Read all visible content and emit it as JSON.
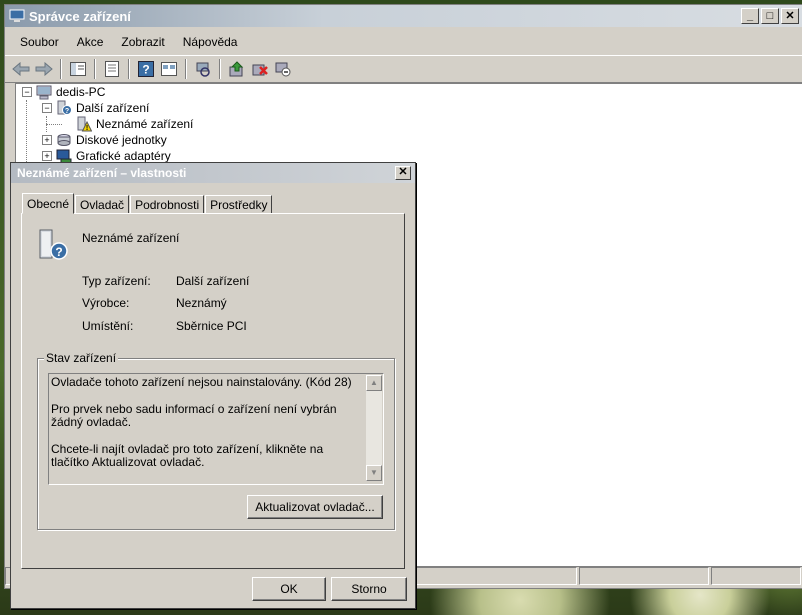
{
  "window": {
    "title": "Správce zařízení",
    "controls": [
      "_",
      "□",
      "✕"
    ]
  },
  "menu": [
    "Soubor",
    "Akce",
    "Zobrazit",
    "Nápověda"
  ],
  "toolbar_icons": [
    "back-icon",
    "forward-icon",
    "show-hide-tree-icon",
    "properties-icon",
    "help-icon",
    "view-icon",
    "scan-hardware-icon",
    "update-driver-icon",
    "uninstall-icon",
    "disable-icon"
  ],
  "tree": {
    "root": "dedis-PC",
    "other_devices": "Další zařízení",
    "unknown_device": "Neznámé zařízení",
    "disk_drives": "Diskové jednotky",
    "display_adapters": "Grafické adaptéry"
  },
  "dialog": {
    "title": "Neznámé zařízení – vlastnosti",
    "close": "✕",
    "tabs": [
      "Obecné",
      "Ovladač",
      "Podrobnosti",
      "Prostředky"
    ],
    "device_name": "Neznámé zařízení",
    "props": [
      {
        "key": "Typ zařízení:",
        "value": "Další zařízení"
      },
      {
        "key": "Výrobce:",
        "value": "Neznámý"
      },
      {
        "key": "Umístění:",
        "value": "Sběrnice PCI"
      }
    ],
    "status_group": "Stav zařízení",
    "status_lines": [
      "Ovladače tohoto zařízení nejsou nainstalovány. (Kód 28)",
      "Pro prvek nebo sadu informací o zařízení není vybrán žádný ovladač.",
      "Chcete-li najít ovladač pro toto zařízení, klikněte na tlačítko Aktualizovat ovladač."
    ],
    "update_button": "Aktualizovat ovladač...",
    "ok_button": "OK",
    "cancel_button": "Storno"
  }
}
